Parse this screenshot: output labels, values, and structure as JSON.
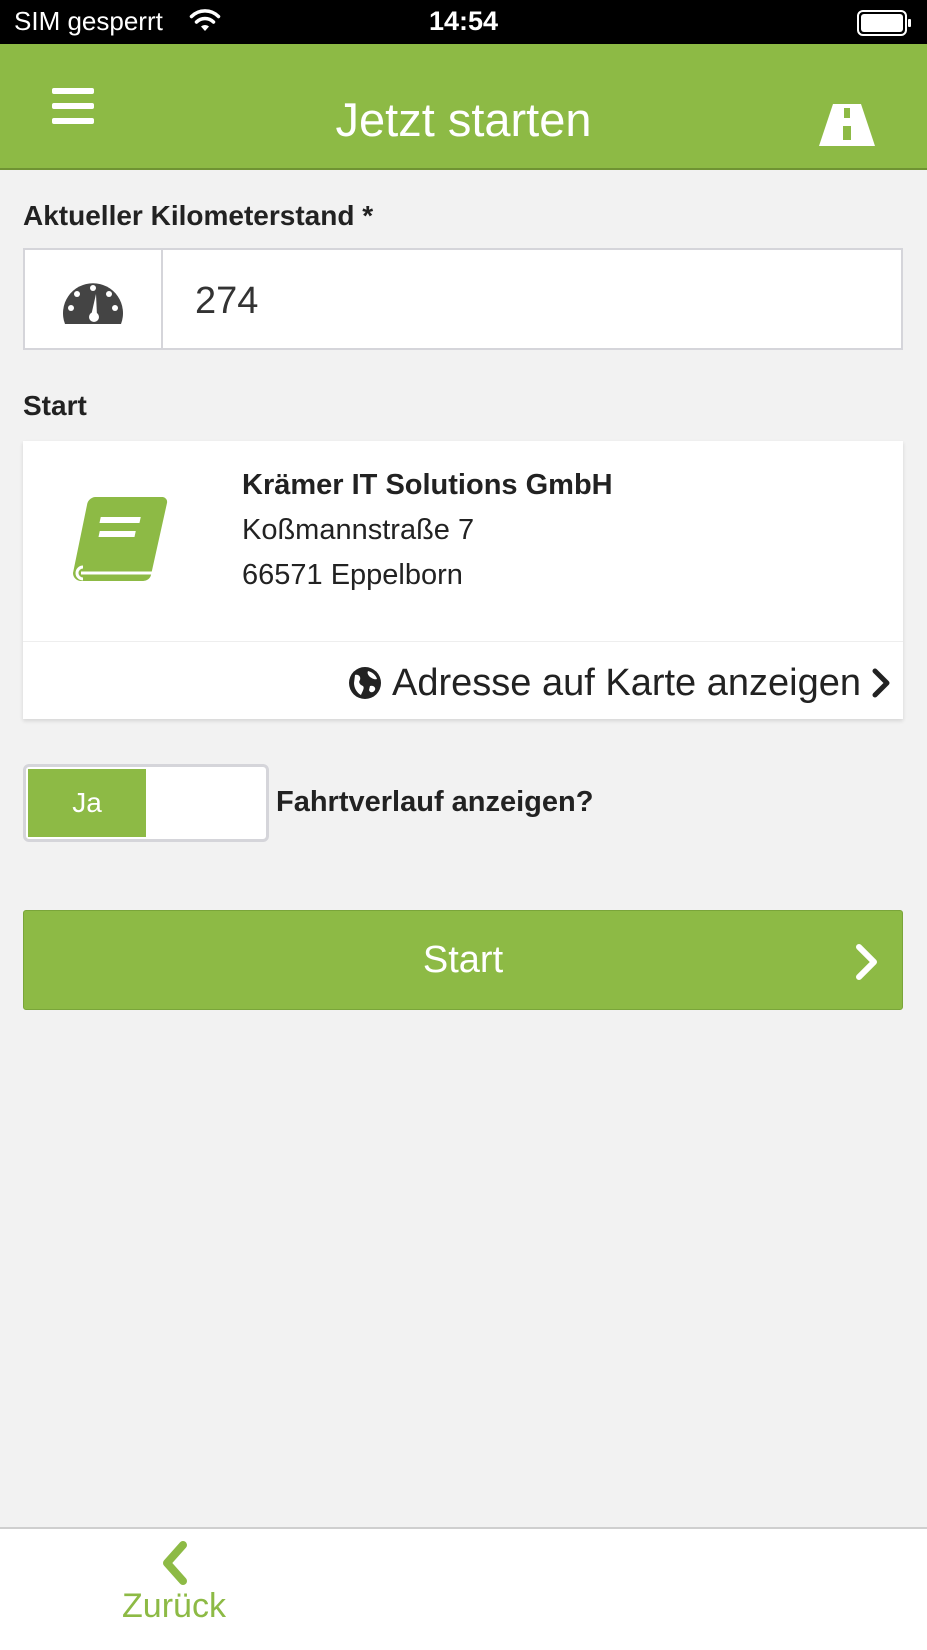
{
  "status_bar": {
    "carrier": "SIM gesperrt",
    "time": "14:54"
  },
  "header": {
    "title": "Jetzt starten",
    "menu_icon": "hamburger-menu-icon",
    "right_icon": "road-icon"
  },
  "odometer": {
    "label": "Aktueller Kilometerstand *",
    "value": "274",
    "icon": "speedometer-icon"
  },
  "start": {
    "label": "Start",
    "icon": "address-book-icon",
    "company": "Krämer IT Solutions GmbH",
    "street": "Koßmannstraße 7",
    "city": "66571 Eppelborn",
    "map_link": "Adresse auf Karte anzeigen"
  },
  "toggle": {
    "on_label": "Ja",
    "question": "Fahrtverlauf anzeigen?",
    "checked": true
  },
  "start_button": {
    "label": "Start"
  },
  "bottom_nav": {
    "back_label": "Zurück"
  },
  "colors": {
    "accent": "#8dba45",
    "status_bar": "#000000",
    "background": "#f2f2f2"
  }
}
